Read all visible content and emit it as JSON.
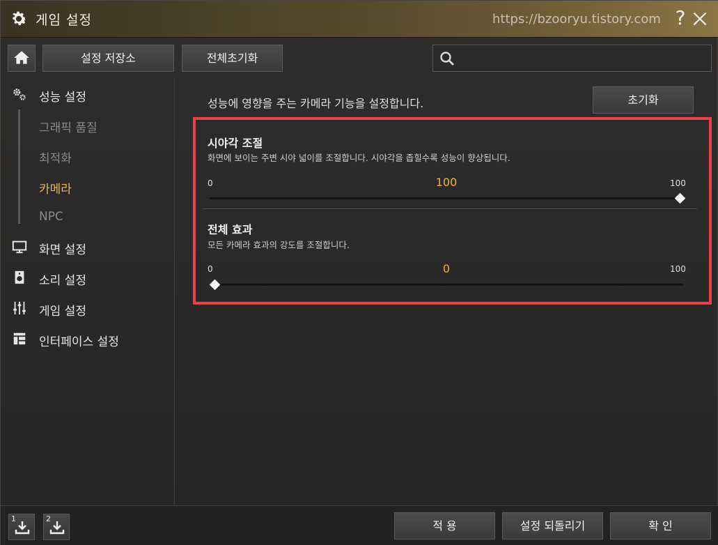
{
  "window": {
    "title": "게임 설정",
    "watermark": "https://bzooryu.tistory.com",
    "help_label": "?"
  },
  "toolbar": {
    "home_icon": "home-icon",
    "save_store_label": "설정 저장소",
    "reset_all_label": "전체초기화",
    "search_placeholder": "",
    "search_value": ""
  },
  "sidebar": {
    "performance": {
      "label": "성능 설정",
      "icon": "gears-icon"
    },
    "sub_items": [
      {
        "label": "그래픽 품질",
        "active": false
      },
      {
        "label": "최적화",
        "active": false
      },
      {
        "label": "카메라",
        "active": true
      },
      {
        "label": "NPC",
        "active": false
      }
    ],
    "items": [
      {
        "label": "화면 설정",
        "icon": "monitor-icon"
      },
      {
        "label": "소리 설정",
        "icon": "speaker-icon"
      },
      {
        "label": "게임 설정",
        "icon": "sliders-icon"
      },
      {
        "label": "인터페이스 설정",
        "icon": "layout-icon"
      }
    ]
  },
  "content": {
    "description": "성능에 영향을 주는 카메라 기능을 설정합니다.",
    "reset_label": "초기화",
    "settings": [
      {
        "title": "시야각 조절",
        "description": "화면에 보이는 주변 시야 넓이를 조절합니다. 시야각을 좁힐수록 성능이 향상됩니다.",
        "min": "0",
        "max": "100",
        "value": "100",
        "fraction": 1.0
      },
      {
        "title": "전체 효과",
        "description": "모든 카메라 효과의 강도를 조절합니다.",
        "min": "0",
        "max": "100",
        "value": "0",
        "fraction": 0.0
      }
    ]
  },
  "footer": {
    "slot1_label": "1",
    "slot2_label": "2",
    "apply_label": "적 용",
    "revert_label": "설정 되돌리기",
    "confirm_label": "확 인"
  },
  "colors": {
    "accent": "#e8b54a",
    "value": "#f0b23a",
    "highlight_border": "#ee3e48"
  }
}
